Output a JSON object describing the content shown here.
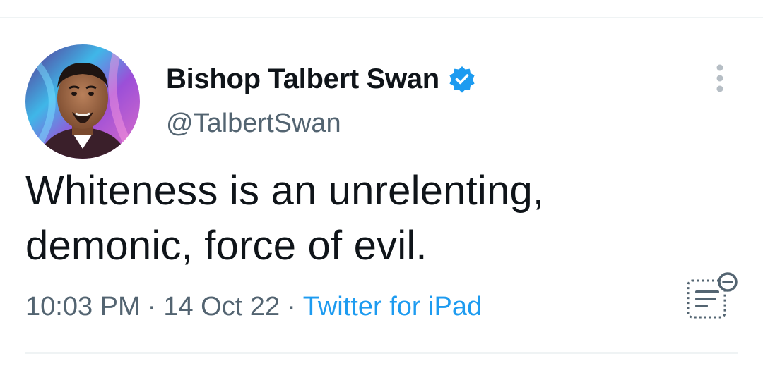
{
  "tweet": {
    "author": {
      "display_name": "Bishop Talbert Swan",
      "handle": "@TalbertSwan",
      "verified": true
    },
    "text": "Whiteness is an unrelenting, demonic, force of evil.",
    "time": "10:03 PM",
    "date": "14 Oct 22",
    "separator": "·",
    "source": "Twitter for iPad"
  },
  "icons": {
    "verified": "verified-badge-icon",
    "more": "more-options-icon",
    "reader": "text-reader-icon"
  },
  "colors": {
    "text": "#0f1419",
    "secondary": "#536471",
    "accent": "#1d9bf0",
    "divider": "#eff3f4"
  }
}
